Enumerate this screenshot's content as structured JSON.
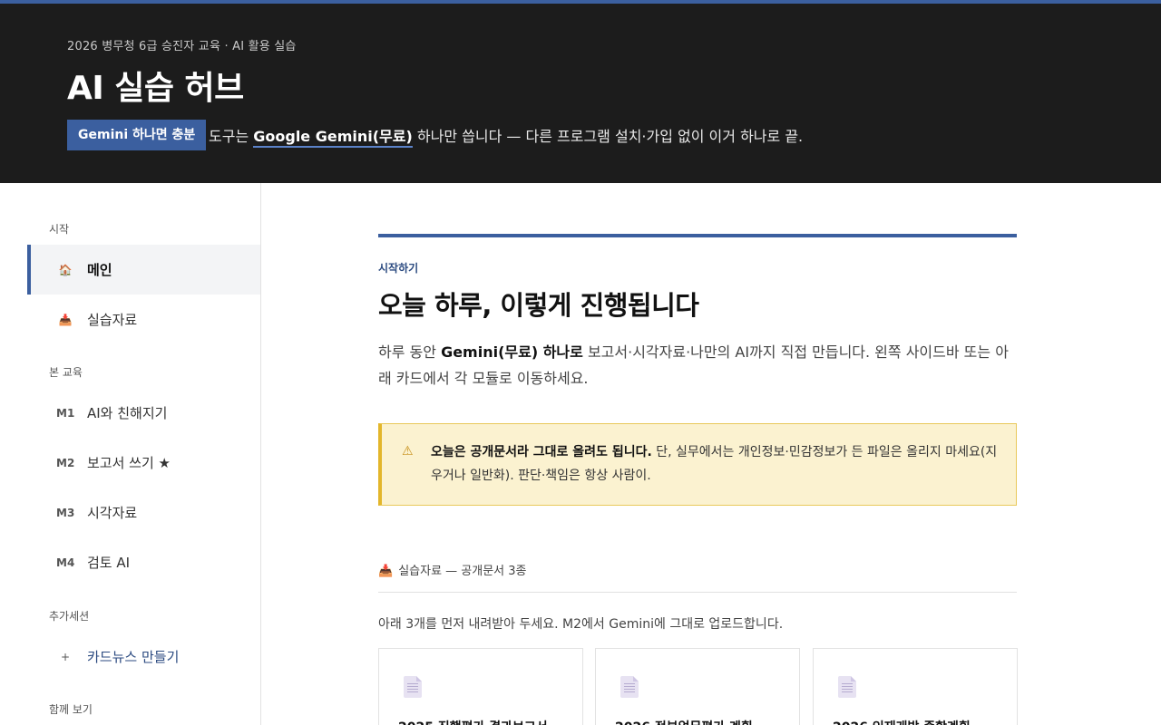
{
  "colors": {
    "accent": "#3b5f9f",
    "hero_bg": "#1c1c1c",
    "warn_bg": "#fbf2d0",
    "warn_border": "#e3b62b"
  },
  "hero": {
    "eyebrow": "2026 병무청 6급 승진자 교육 · AI 활용 실습",
    "title": "AI 실습 허브",
    "badge": "Gemini 하나면 충분",
    "line_before": "도구는 ",
    "line_strong": "Google Gemini(무료)",
    "line_after": " 하나만 씁니다 — 다른 프로그램 설치·가입 없이 이거 하나로 끝."
  },
  "sidebar": {
    "sections": [
      {
        "label": "시작"
      },
      {
        "label": "본 교육"
      },
      {
        "label": "추가세션"
      },
      {
        "label": "함께 보기"
      }
    ],
    "items": [
      {
        "icon": "🏠",
        "icon_name": "home-icon",
        "label": "메인",
        "active": true
      },
      {
        "icon": "📥",
        "icon_name": "inbox-tray-icon",
        "label": "실습자료"
      },
      {
        "code": "M1",
        "label": "AI와 친해지기"
      },
      {
        "code": "M2",
        "label": "보고서 쓰기 ★"
      },
      {
        "code": "M3",
        "label": "시각자료"
      },
      {
        "code": "M4",
        "label": "검토 AI"
      },
      {
        "icon": "+",
        "icon_name": "plus-icon",
        "label": "카드뉴스 만들기"
      }
    ]
  },
  "main": {
    "kicker": "시작하기",
    "title": "오늘 하루, 이렇게 진행됩니다",
    "lead_before": "하루 동안 ",
    "lead_strong": "Gemini(무료) 하나로",
    "lead_after": " 보고서·시각자료·나만의 AI까지 직접 만듭니다. 왼쪽 사이드바 또는 아래 카드에서 각 모듈로 이동하세요.",
    "warning": {
      "icon": "⚠",
      "strong": "오늘은 공개문서라 그대로 올려도 됩니다.",
      "text": " 단, 실무에서는 개인정보·민감정보가 든 파일은 올리지 마세요(지우거나 일반화). 판단·책임은 항상 사람이."
    },
    "section": {
      "icon": "📥",
      "title": "실습자료 — 공개문서 3종",
      "note": "아래 3개를 먼저 내려받아 두세요. M2에서 Gemini에 그대로 업로드합니다."
    },
    "cards": [
      {
        "title": "2025 진행평가 결과보고서"
      },
      {
        "title": "2026 정부업무평가 계획"
      },
      {
        "title": "2026 인재개발 종합계획"
      }
    ]
  }
}
